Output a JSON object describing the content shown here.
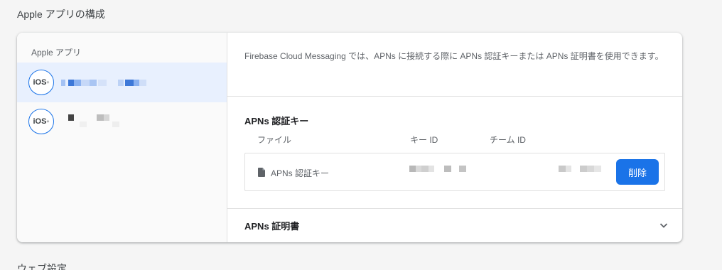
{
  "page": {
    "section_title": "Apple アプリの構成",
    "next_section_title": "ウェブ設定"
  },
  "sidebar": {
    "header": "Apple アプリ",
    "apps": [
      {
        "badge": "iOS",
        "badge_sup": "+",
        "selected": true
      },
      {
        "badge": "iOS",
        "badge_sup": "+",
        "selected": false
      }
    ]
  },
  "main": {
    "description": "Firebase Cloud Messaging では、APNs に接続する際に APNs 認証キーまたは APNs 証明書を使用できます。",
    "apns_key": {
      "title": "APNs 認証キー",
      "columns": [
        "ファイル",
        "キー ID",
        "チーム ID"
      ],
      "file_label": "APNs 認証キー",
      "delete_label": "削除"
    },
    "apns_cert": {
      "title": "APNs 証明書"
    }
  },
  "colors": {
    "accent": "#1a73e8",
    "selected_bg": "#e8f0fe"
  }
}
